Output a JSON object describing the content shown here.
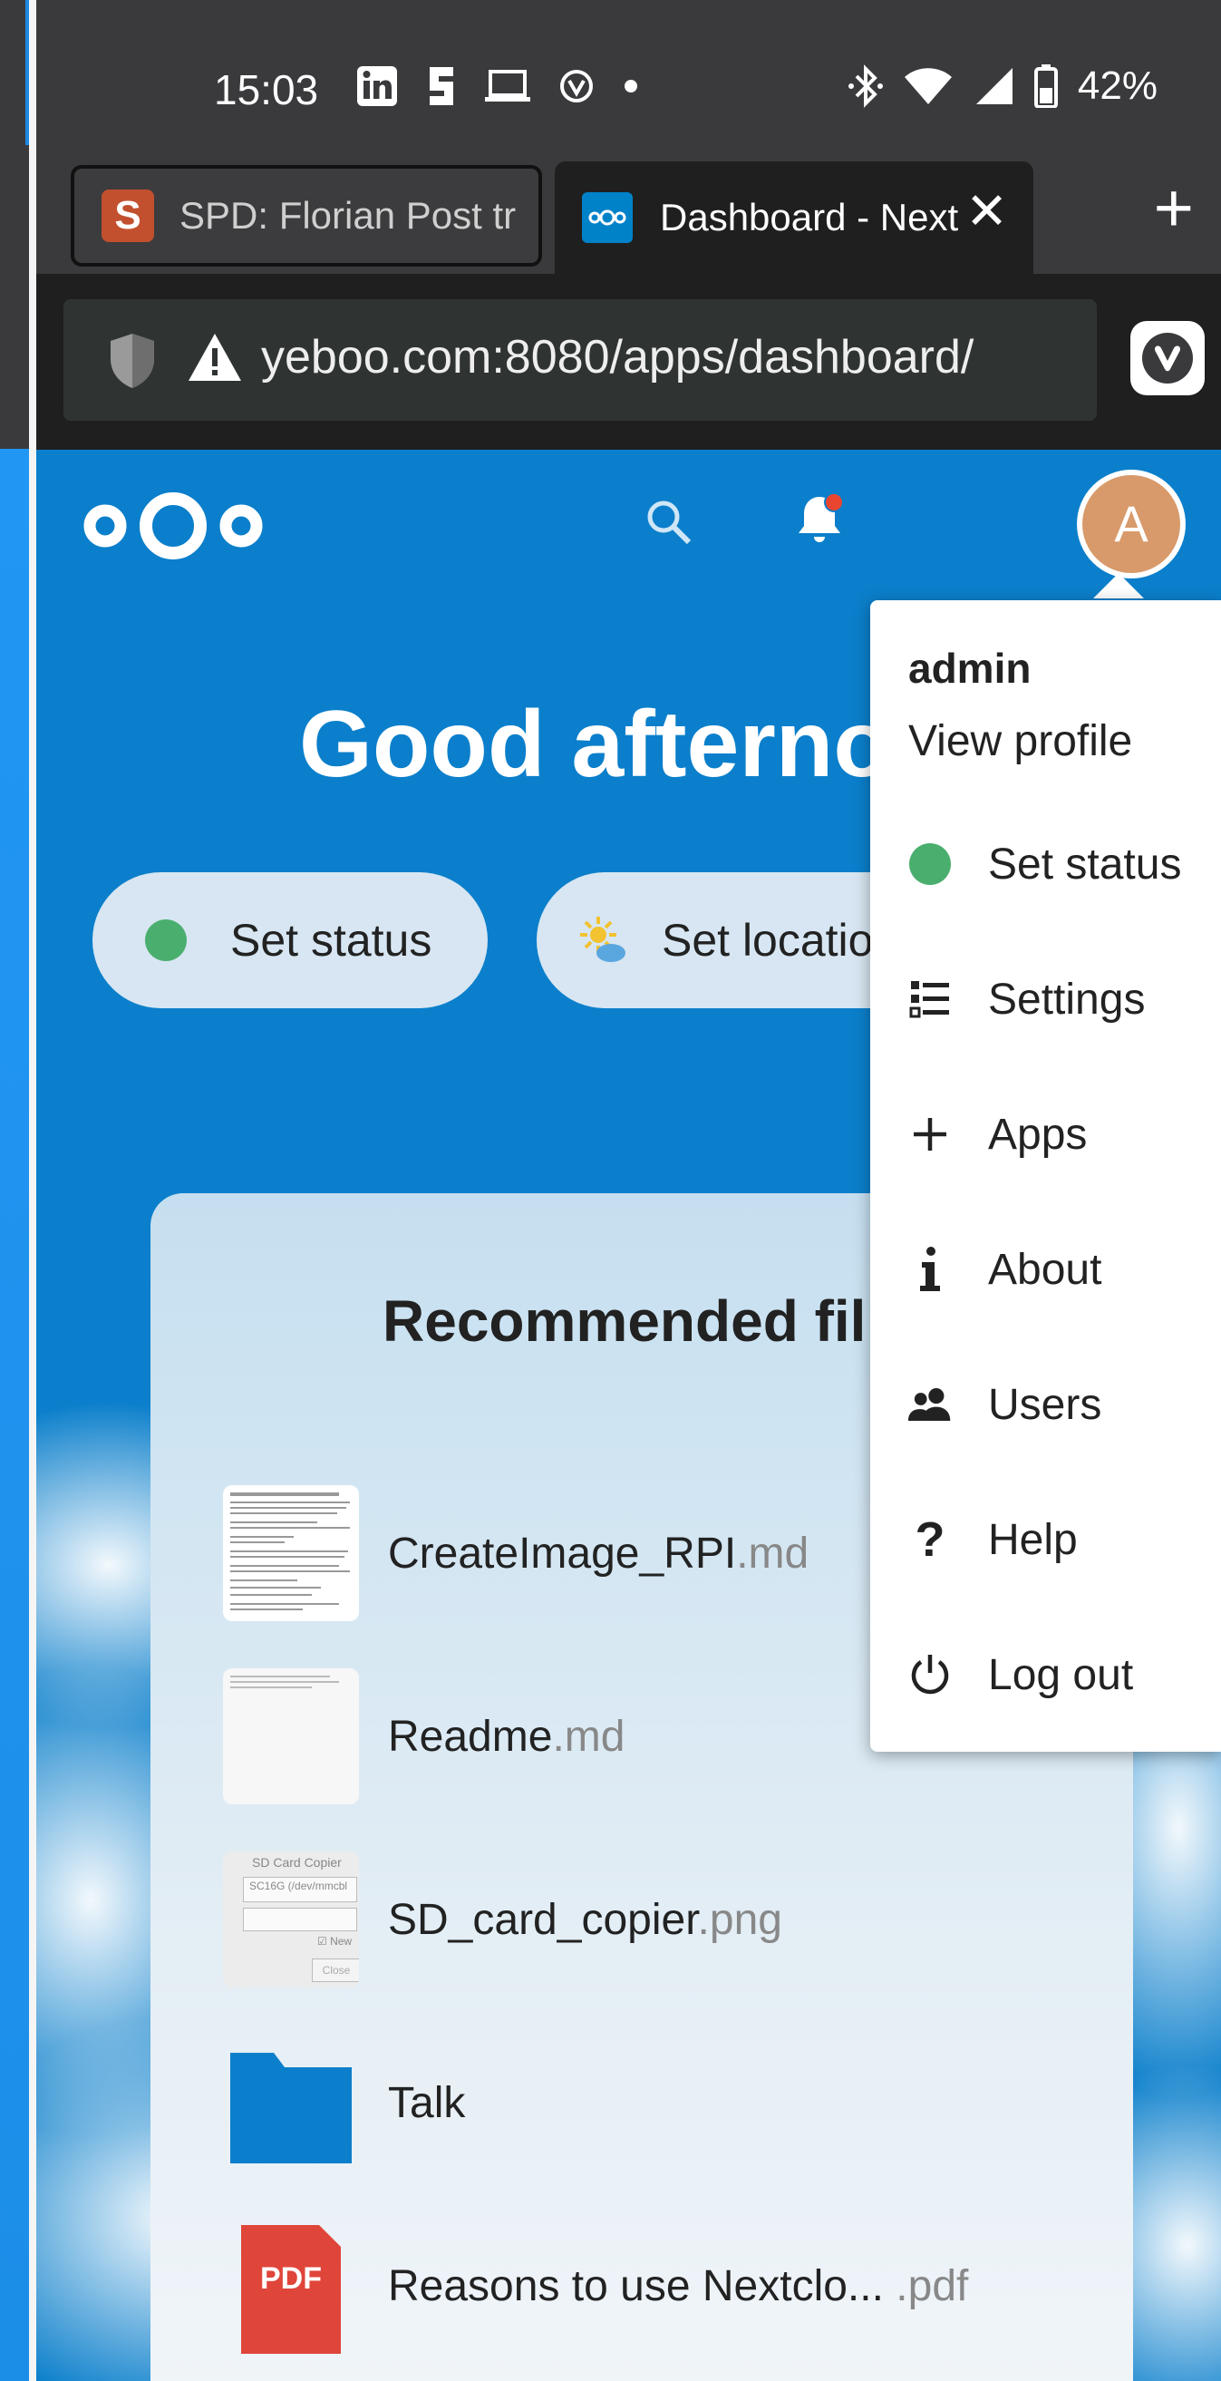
{
  "statusbar": {
    "time": "15:03",
    "battery": "42%"
  },
  "browser": {
    "tabs": [
      {
        "label": "SPD: Florian Post tr",
        "favicon": "S"
      },
      {
        "label": "Dashboard - Nextcloud",
        "favicon": "nextcloud"
      }
    ],
    "url": "yeboo.com:8080/apps/dashboard/"
  },
  "nextcloud": {
    "greeting": "Good afterno",
    "avatar_letter": "A",
    "status_pill": "Set status",
    "location_pill": "Set locatio",
    "card_title": "Recommended fil",
    "files": [
      {
        "name": "CreateImage_RPI",
        "ext": ".md"
      },
      {
        "name": "Readme",
        "ext": ".md"
      },
      {
        "name": "SD_card_copier",
        "ext": ".png"
      },
      {
        "name": "Talk",
        "ext": ""
      },
      {
        "name": "Reasons to use Nextclo... ",
        "ext": ".pdf"
      }
    ],
    "pdf_label": "PDF",
    "sd_thumb_title": "SD Card Copier",
    "sd_thumb_field": "SC16G (/dev/mmcbl",
    "sd_thumb_check": "New",
    "sd_thumb_close": "Close"
  },
  "menu": {
    "user": "admin",
    "view_profile": "View profile",
    "items": [
      {
        "label": "Set status",
        "icon": "status-dot-icon"
      },
      {
        "label": "Settings",
        "icon": "settings-list-icon"
      },
      {
        "label": "Apps",
        "icon": "plus-icon"
      },
      {
        "label": "About",
        "icon": "info-icon"
      },
      {
        "label": "Users",
        "icon": "users-icon"
      },
      {
        "label": "Help",
        "icon": "help-icon"
      },
      {
        "label": "Log out",
        "icon": "power-icon"
      }
    ]
  },
  "colors": {
    "nextcloud_blue": "#0b7fcb",
    "avatar": "#d89a6a",
    "status_green": "#4aae6e",
    "pdf_red": "#e0453a",
    "folder_blue": "#0b7fcb"
  }
}
